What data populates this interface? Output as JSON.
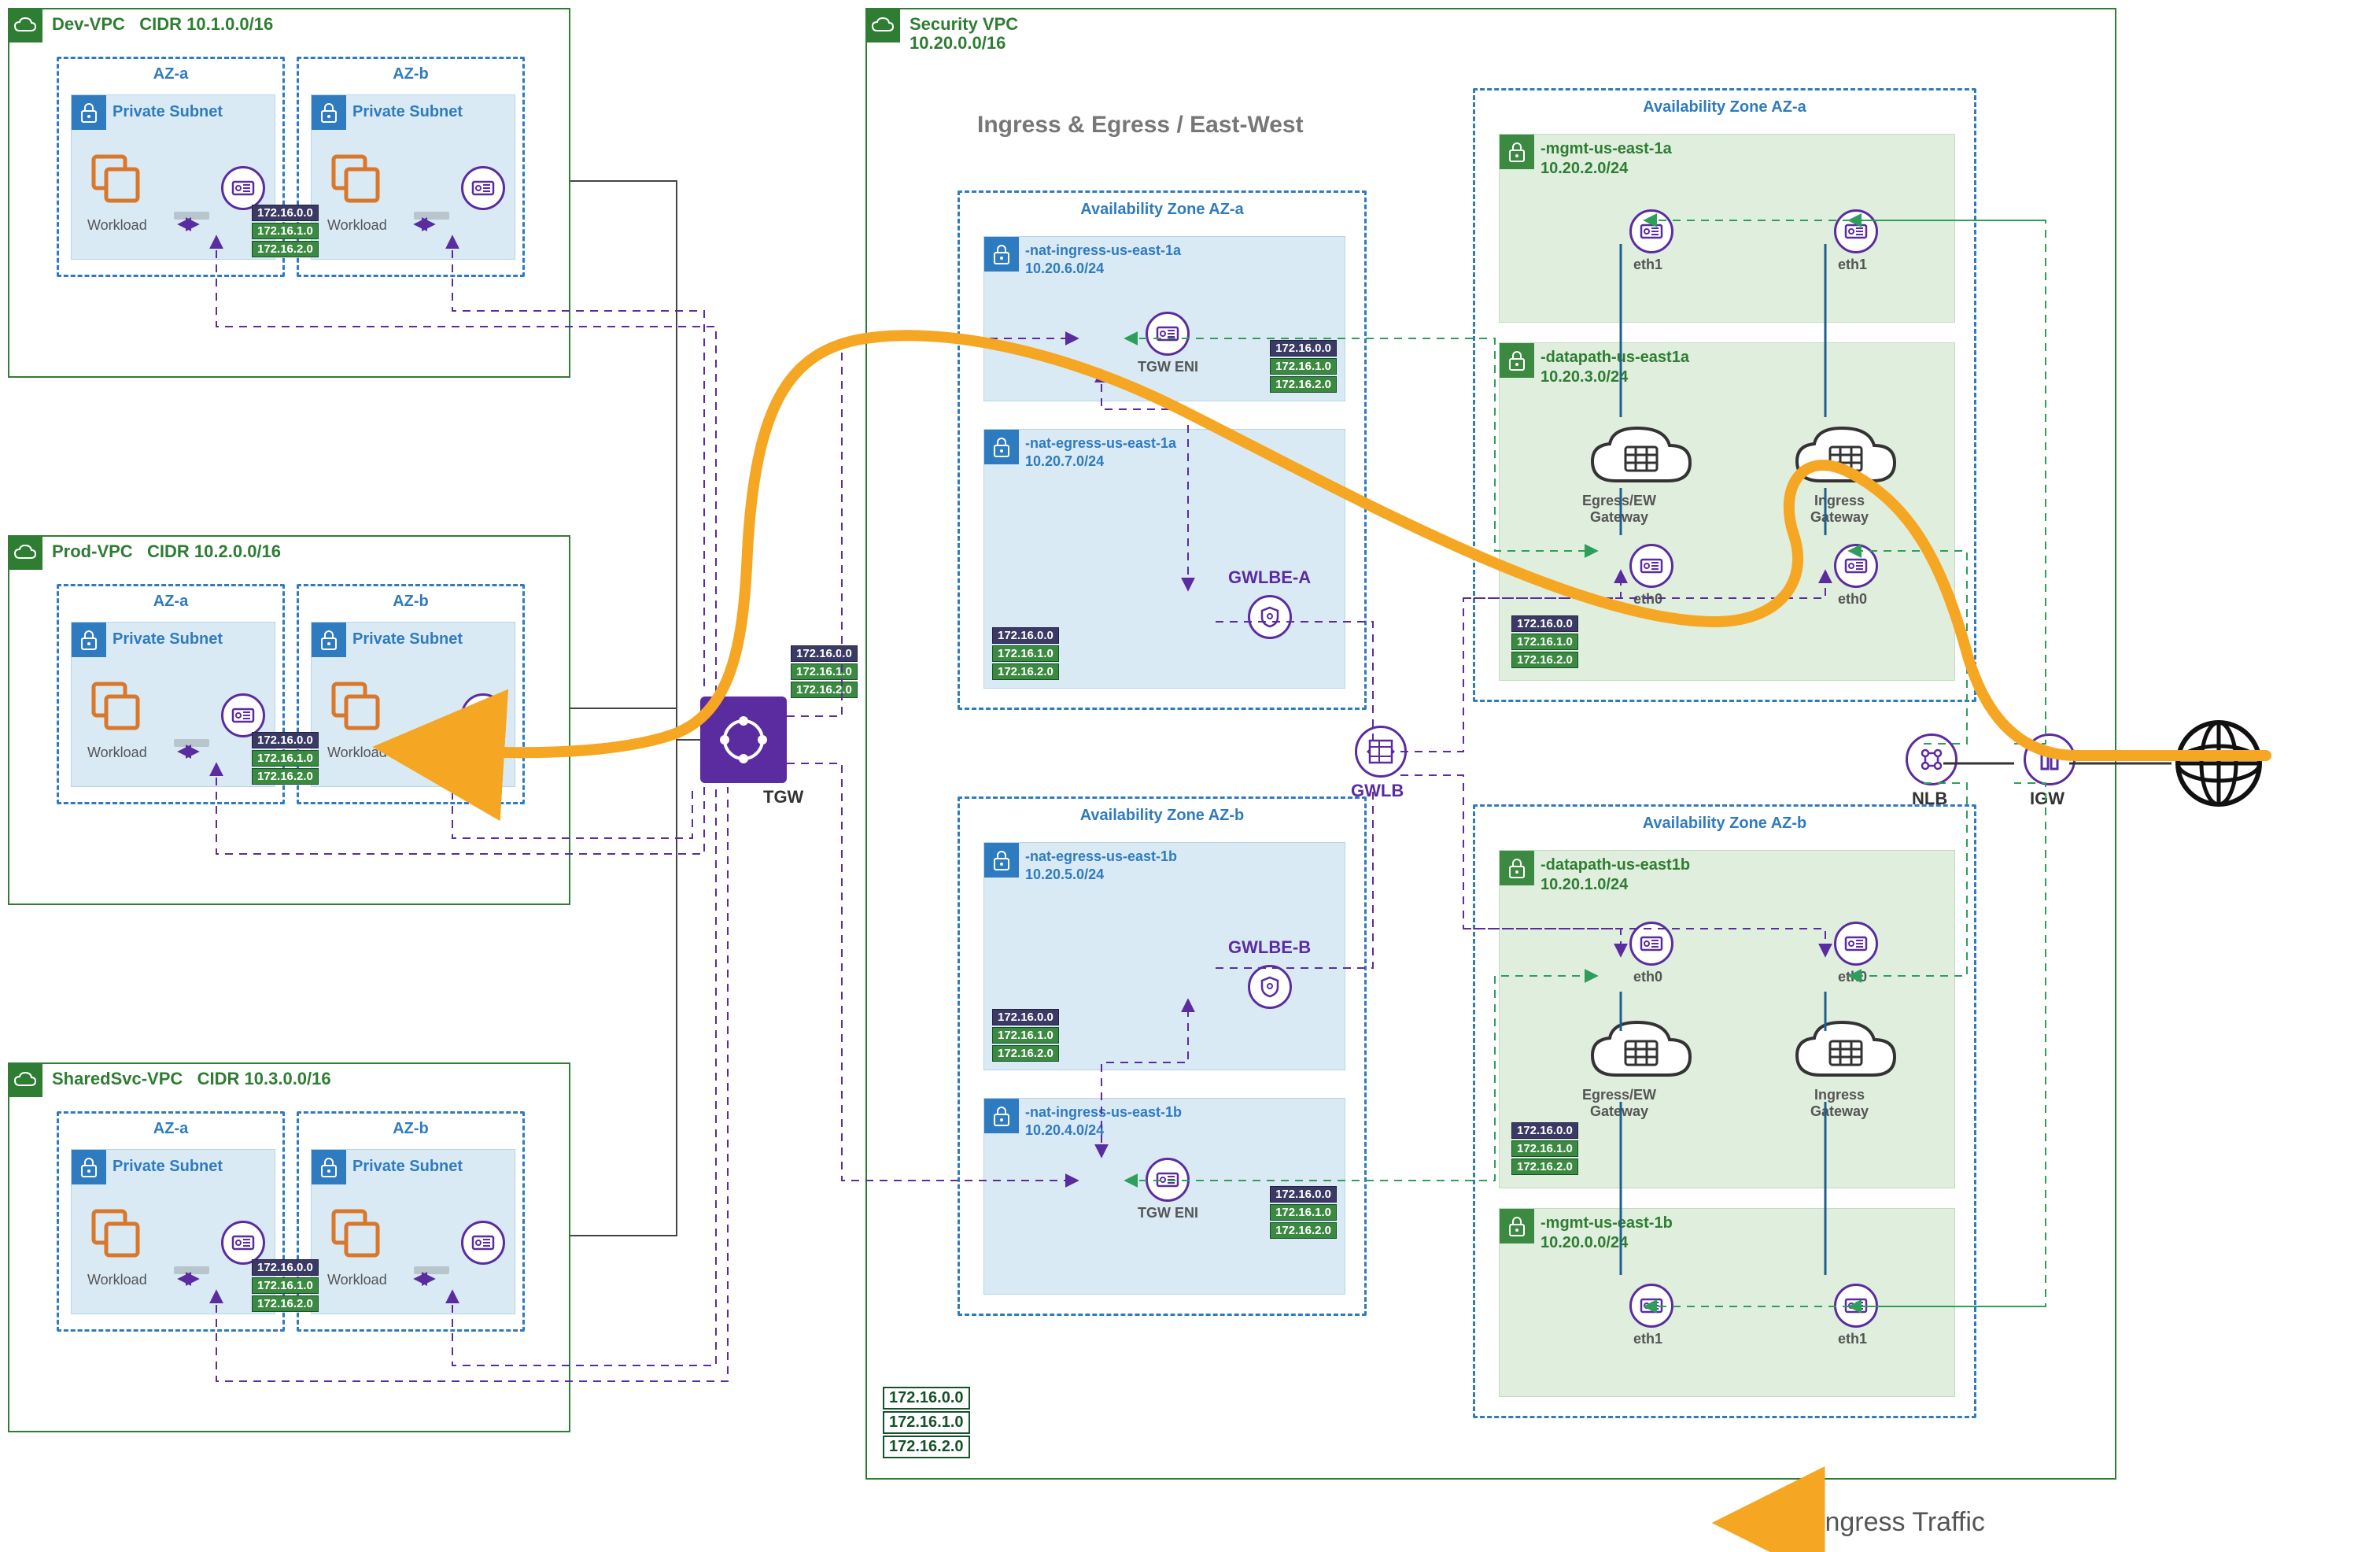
{
  "vpcs": {
    "dev": {
      "name": "Dev-VPC",
      "cidr": "CIDR 10.1.0.0/16"
    },
    "prod": {
      "name": "Prod-VPC",
      "cidr": "CIDR 10.2.0.0/16"
    },
    "shared": {
      "name": "SharedSvc-VPC",
      "cidr": "CIDR 10.3.0.0/16"
    },
    "sec": {
      "name": "Security VPC",
      "cidr": "10.20.0.0/16"
    }
  },
  "az": {
    "a": "AZ-a",
    "b": "AZ-b"
  },
  "common": {
    "private_subnet": "Private Subnet",
    "workload": "Workload",
    "tgw": "TGW",
    "tgw_eni": "TGW ENI",
    "gwlb": "GWLB",
    "gwlbe_a": "GWLBE-A",
    "gwlbe_b": "GWLBE-B",
    "nlb": "NLB",
    "igw": "IGW",
    "eth0": "eth0",
    "eth1": "eth1",
    "egress_ew_gateway": "Egress/EW\nGateway",
    "ingress_gateway": "Ingress\nGateway",
    "avail_zone_a": "Availability Zone AZ-a",
    "avail_zone_b": "Availability Zone AZ-b",
    "section_heading": "Ingress & Egress / East-West",
    "ingress_traffic": "Ingress Traffic"
  },
  "subnets": {
    "nat_ingress_a": {
      "name": "-nat-ingress-us-east-1a",
      "cidr": "10.20.6.0/24"
    },
    "nat_egress_a": {
      "name": "-nat-egress-us-east-1a",
      "cidr": "10.20.7.0/24"
    },
    "nat_egress_b": {
      "name": "-nat-egress-us-east-1b",
      "cidr": "10.20.5.0/24"
    },
    "nat_ingress_b": {
      "name": "-nat-ingress-us-east-1b",
      "cidr": "10.20.4.0/24"
    },
    "mgmt_a": {
      "name": "-mgmt-us-east-1a",
      "cidr": "10.20.2.0/24"
    },
    "datapath_a": {
      "name": "-datapath-us-east1a",
      "cidr": "10.20.3.0/24"
    },
    "datapath_b": {
      "name": "-datapath-us-east1b",
      "cidr": "10.20.1.0/24"
    },
    "mgmt_b": {
      "name": "-mgmt-us-east-1b",
      "cidr": "10.20.0.0/24"
    }
  },
  "route_tags": {
    "a": "172.16.0.0",
    "b": "172.16.1.0",
    "c": "172.16.2.0"
  }
}
